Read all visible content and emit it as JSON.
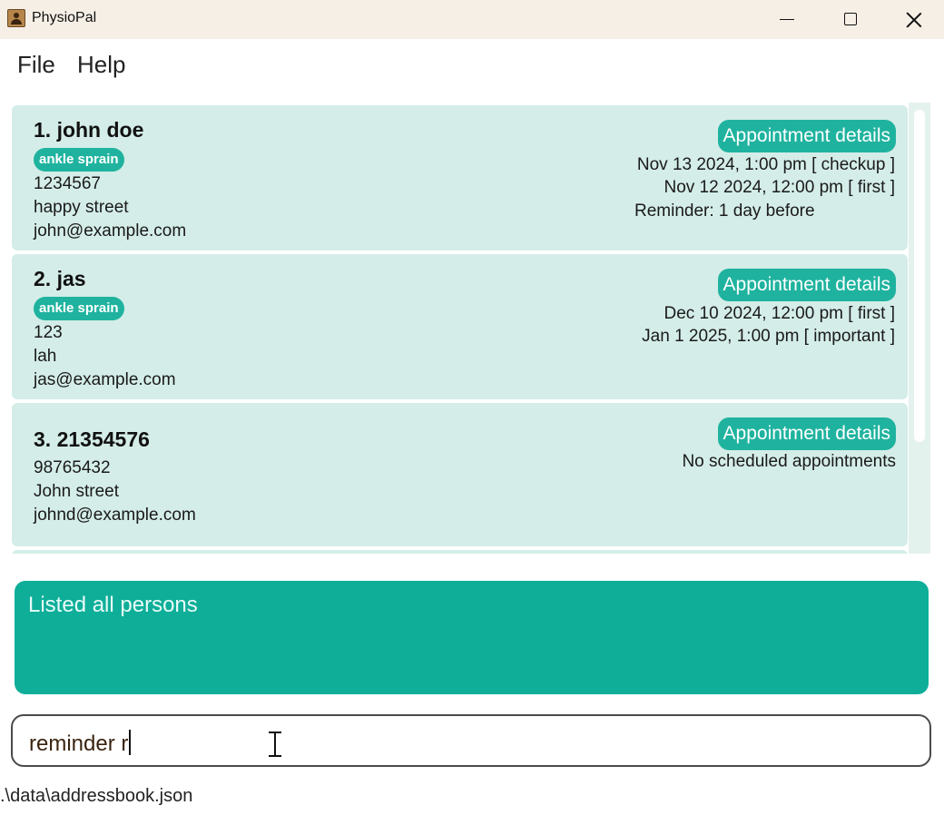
{
  "window": {
    "title": "PhysioPal",
    "icon": "app-contact-icon"
  },
  "menu": {
    "items": [
      "File",
      "Help"
    ]
  },
  "persons": [
    {
      "name": "1. john doe",
      "tags": [
        "ankle sprain"
      ],
      "phone": "1234567",
      "address": "happy street",
      "email": "john@example.com",
      "appointment_button": "Appointment details",
      "appointments": [
        "Nov 13 2024, 1:00 pm [ checkup ]",
        "Nov 12 2024, 12:00 pm [ first ]"
      ],
      "reminder": "Reminder: 1 day before"
    },
    {
      "name": "2. jas",
      "tags": [
        "ankle sprain"
      ],
      "phone": "123",
      "address": "lah",
      "email": "jas@example.com",
      "appointment_button": "Appointment details",
      "appointments": [
        "Dec 10 2024, 12:00 pm [ first ]",
        "Jan 1 2025, 1:00 pm [ important ]"
      ]
    },
    {
      "name": "3. 21354576",
      "tags": [],
      "phone": "98765432",
      "address": "John street",
      "email": "johnd@example.com",
      "appointment_button": "Appointment details",
      "appointments": [
        "No scheduled appointments"
      ]
    }
  ],
  "result": {
    "text": "Listed all persons"
  },
  "command": {
    "value": "reminder r"
  },
  "status": {
    "path": ".\\data\\addressbook.json"
  },
  "colors": {
    "accent": "#1fb39f",
    "card": "#d4ede8",
    "result_bg": "#0eae99",
    "titlebar": "#f6efe6"
  }
}
